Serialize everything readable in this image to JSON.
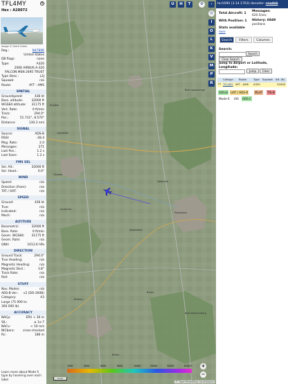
{
  "aircraft": {
    "callsign": "TFL4MY",
    "hex_label": "Hex : A28072",
    "photo_credit": "Image © Gerrit Griem",
    "fields": [
      {
        "key": "Reg.:",
        "value": "N4786K",
        "link": true
      },
      {
        "key": "",
        "value": "United States"
      },
      {
        "key": "DB flags:",
        "value": "none"
      },
      {
        "key": "Type:",
        "value": "A320"
      },
      {
        "key": "",
        "value": "2006 AIRBUS A-320"
      },
      {
        "key": "",
        "value": "FALCON MSN 2695 TRUST"
      },
      {
        "key": "Type Desc.:",
        "value": "L2J"
      },
      {
        "key": "Squawk:",
        "value": "n/a"
      },
      {
        "key": "Route:",
        "value": "AYT - AMS"
      }
    ]
  },
  "sections": [
    {
      "title": "SPATIAL",
      "rows": [
        {
          "key": "Groundspeed:",
          "value": "436 kt"
        },
        {
          "key": "Baro. altitude:",
          "value": "32000 ft"
        },
        {
          "key": "WGS84 altitude:",
          "value": "31175 ft"
        },
        {
          "key": "Vert. Rate:",
          "value": "0 ft/min"
        },
        {
          "key": "Track:",
          "value": "294.0°"
        },
        {
          "key": "Pos.:",
          "value": "51.731°, 8.570°"
        },
        {
          "key": "Distance:",
          "value": "130.3 nmi"
        }
      ]
    },
    {
      "title": "SIGNAL",
      "rows": [
        {
          "key": "Source:",
          "value": "ADS-B"
        },
        {
          "key": "RSSI:",
          "value": "-28.4"
        },
        {
          "key": "Msg. Rate:",
          "value": "2.0"
        },
        {
          "key": "Messages:",
          "value": "271"
        },
        {
          "key": "Last Pos.:",
          "value": "1.2 s"
        },
        {
          "key": "Last Seen:",
          "value": "1.2 s"
        }
      ]
    },
    {
      "title": "FMS SEL",
      "rows": [
        {
          "key": "Sel. Alt.:",
          "value": "32000 ft"
        },
        {
          "key": "Sel. Head.:",
          "value": "0.0°"
        }
      ]
    },
    {
      "title": "WIND",
      "rows": [
        {
          "key": "Speed:",
          "value": "n/a"
        },
        {
          "key": "Direction (from):",
          "value": "n/a"
        },
        {
          "key": "TAT / OAT:",
          "value": "n/a"
        }
      ]
    },
    {
      "title": "SPEED",
      "rows": [
        {
          "key": "Ground:",
          "value": "436 kt"
        },
        {
          "key": "True:",
          "value": "n/a"
        },
        {
          "key": "Indicated:",
          "value": "n/a"
        },
        {
          "key": "Mach:",
          "value": "n/a"
        }
      ]
    },
    {
      "title": "ALTITUDE",
      "rows": [
        {
          "key": "Barometric:",
          "value": "32000 ft"
        },
        {
          "key": "Baro. Rate:",
          "value": "0 ft/min"
        },
        {
          "key": "Geom. WGS84:",
          "value": "31175 ft"
        },
        {
          "key": "Geom. Rate:",
          "value": "n/a"
        },
        {
          "key": "QNH:",
          "value": "1013.6 hPa"
        }
      ]
    },
    {
      "title": "DIRECTION",
      "rows": [
        {
          "key": "Ground Track:",
          "value": "294.0°"
        },
        {
          "key": "True Heading:",
          "value": "n/a"
        },
        {
          "key": "Magnetic Heading:",
          "value": "n/a"
        },
        {
          "key": "Magnetic Decl.:",
          "value": "3.8°"
        },
        {
          "key": "Track Rate:",
          "value": "n/a"
        },
        {
          "key": "Roll:",
          "value": "n/a"
        }
      ]
    },
    {
      "title": "STUFF",
      "rows": [
        {
          "key": "Nav. Modes:",
          "value": "n/a"
        },
        {
          "key": "ADS-B Ver.:",
          "value": "v2 (DO-260B)"
        },
        {
          "key": "Category:",
          "value": "A3"
        },
        {
          "key": "Large (75 000 to",
          "value": ""
        },
        {
          "key": "300 000 lb)",
          "value": ""
        }
      ]
    },
    {
      "title": "ACCURACY",
      "rows": [
        {
          "key": "NACp:",
          "value": "EPU < 30 m"
        },
        {
          "key": "SIL:",
          "value": "≤ 1e-7"
        },
        {
          "key": "NACv:",
          "value": "< 10 m/s"
        },
        {
          "key": "NICbaro:",
          "value": "cross-checked"
        },
        {
          "key": "Rc:",
          "value": "186 m"
        }
      ]
    }
  ],
  "learn_more": "Learn more about Mode S type by hovering over each label",
  "map": {
    "top_buttons": [
      "U",
      "H",
      "T"
    ],
    "side_buttons": [
      "I",
      "O",
      "L",
      "K",
      "V",
      "M",
      "P",
      "R"
    ],
    "places": [
      "Lippstadt",
      "Paderborn",
      "Delbrück",
      "Bad Lippspringe",
      "Salzkotten",
      "Büren",
      "Geseke",
      "Anröchte",
      "Rüthen",
      "Bad Wünnenberg",
      "Erwitte",
      "Brilon"
    ],
    "scale_label": "5 km",
    "attribution": "© OpenStreetMap contributors",
    "alt_legend_ticks": [
      "2000",
      "4000",
      "6000",
      "8000",
      "10000",
      "20000",
      "30000",
      "40000+"
    ],
    "zoom_in": "+",
    "zoom_out": "−"
  },
  "right": {
    "version_prefix": "tar1090 ",
    "version_mid": "(3.14.1763) decoder: ",
    "version_link": "readsb",
    "stats": {
      "total_label": "Total Aircraft: 1",
      "position_label": "With Position: 1",
      "stats_label": "Stats available",
      "here_label": "here",
      "messages_label": "Messages:",
      "messages_value": "620.5/sec",
      "history_label": "History: 6849",
      "history_value": "positions"
    },
    "tabs": [
      "Search",
      "Filters",
      "Columns"
    ],
    "search_label": "Search:",
    "search_button": "Search",
    "clear_search_button": "Clear Search",
    "jump_label": "Jump to Airport or Latitude, Longitude:",
    "jump_button": "Jump",
    "clear_button": "Clear",
    "table_headers": [
      "Callsign",
      "Route",
      "Type",
      "Squawk",
      "Alt. (ft)"
    ],
    "row": {
      "flag": "US",
      "callsign": "TFL4MY",
      "route": "AYT - AMS",
      "type": "A320",
      "squawk": "",
      "alt": "32000"
    },
    "legend_tags": [
      {
        "label": "ADS-B",
        "color": "#a7e6a7"
      },
      {
        "label": "UAT / ADS-R",
        "color": "#f2d98a"
      },
      {
        "label": "MLAT",
        "color": "#f0b88c"
      },
      {
        "label": "TIS-B",
        "color": "#f08c8c"
      },
      {
        "label": "Mode-S",
        "color": "#ffffff"
      },
      {
        "label": "AIS",
        "color": "#ffffff"
      },
      {
        "label": "ADS-C",
        "color": "#a7e6a7"
      }
    ]
  },
  "colors": {
    "accent": "#1d3f7a",
    "selected_row": "#fff5b5",
    "aircraft_icon": "#3a3ae6"
  },
  "icons": {
    "close": "close-icon",
    "plane": "plane-icon",
    "settings": "gear-icon"
  }
}
